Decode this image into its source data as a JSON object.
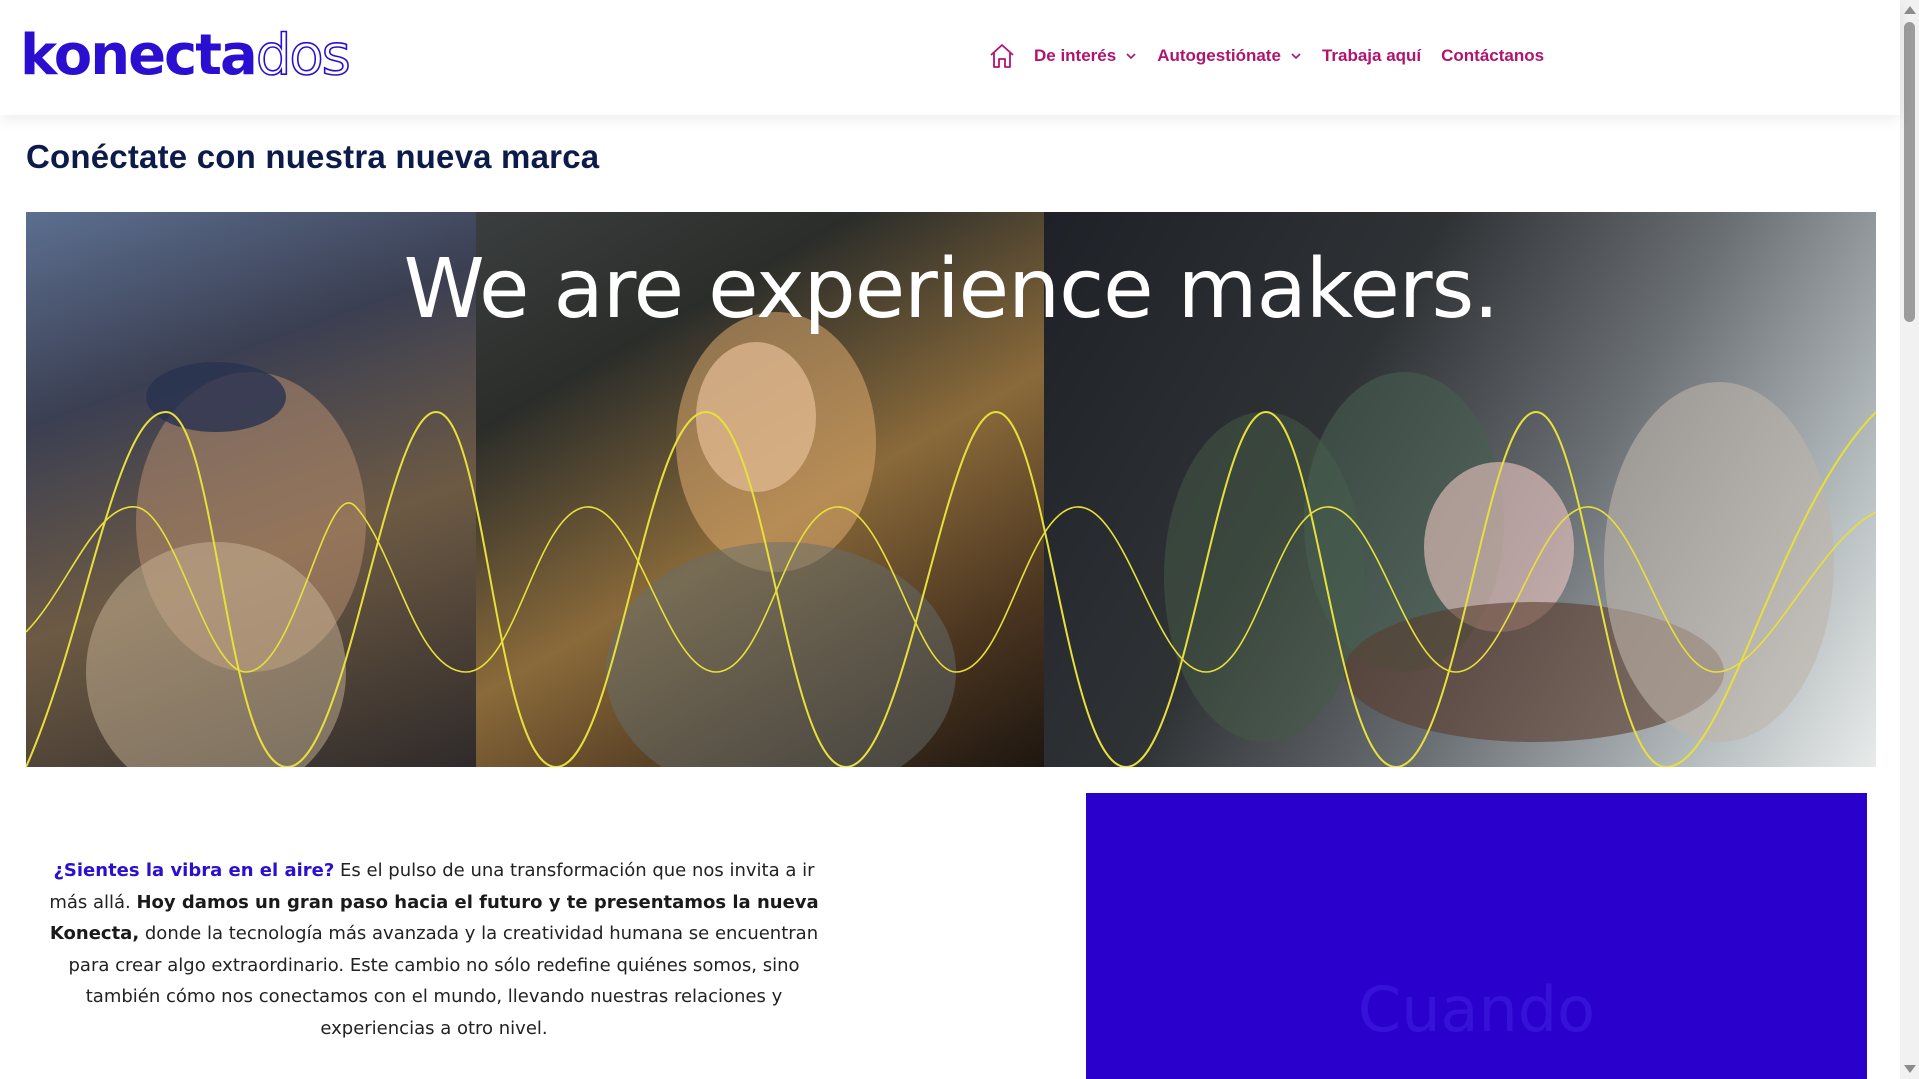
{
  "header": {
    "logo": {
      "part1": "konecta",
      "part2": "dos"
    },
    "nav": {
      "home_icon": "home-icon",
      "items": [
        {
          "label": "De interés",
          "has_dropdown": true
        },
        {
          "label": "Autogestiónate",
          "has_dropdown": true
        },
        {
          "label": "Trabaja aquí",
          "has_dropdown": false
        },
        {
          "label": "Contáctanos",
          "has_dropdown": false
        }
      ]
    }
  },
  "page": {
    "title": "Conéctate con nuestra nueva marca"
  },
  "hero": {
    "headline": "We are experience makers."
  },
  "intro": {
    "lead": "¿Sientes la vibra en el aire?",
    "part1": " Es el pulso de una transformación que nos invita a ir más allá. ",
    "bold": "Hoy damos un gran paso hacia el futuro y te presentamos la nueva Konecta,",
    "part2": " donde la tecnología más avanzada y la creatividad humana se encuentran para crear algo extraordinario. Este cambio no sólo redefine quiénes somos, sino también cómo nos conectamos con el mundo, llevando nuestras relaciones y experiencias a otro nivel."
  },
  "bluebox": {
    "ghost_text": "Cuando"
  },
  "colors": {
    "brand_blue": "#2a0fd0",
    "nav_magenta": "#b01470",
    "title_navy": "#0d1b4a",
    "wave_yellow": "#e8e03a",
    "box_blue": "#2a00cc"
  }
}
